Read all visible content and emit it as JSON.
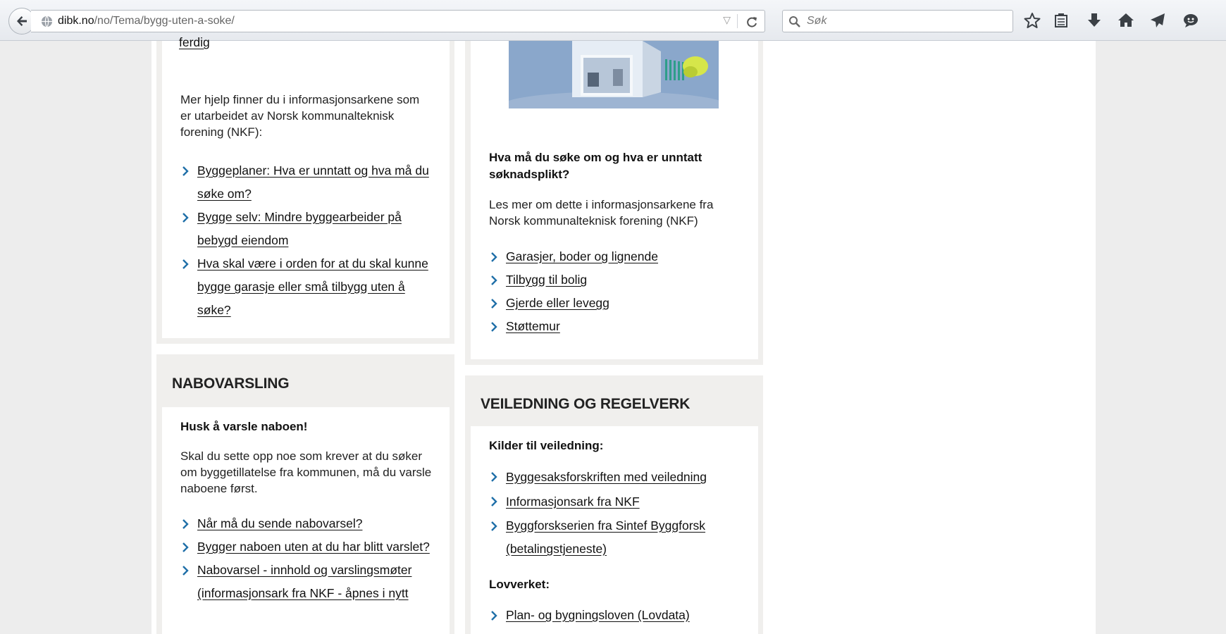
{
  "browser": {
    "url_host": "dibk.no",
    "url_path": "/no/Tema/bygg-uten-a-soke/",
    "search_placeholder": "Søk"
  },
  "left_top": {
    "cutoff_link": "ferdig",
    "intro": "Mer hjelp finner du i informasjonsarkene som er utarbeidet av Norsk kommunalteknisk forening (NKF):",
    "links": [
      "Byggeplaner: Hva er unntatt og hva må du søke om?",
      "Bygge selv: Mindre byggearbeider på bebygd eiendom",
      "Hva skal være i orden for at du skal kunne bygge garasje eller små tilbygg uten å søke?"
    ]
  },
  "nabovarsling": {
    "heading": "NABOVARSLING",
    "subheading": "Husk å varsle naboen!",
    "text": "Skal du sette opp noe som krever at du søker om byggetillatelse fra kommunen, må du varsle naboene først.",
    "links": [
      "Når må du sende nabovarsel?",
      "Bygger naboen uten at du har blitt varslet?",
      "Nabovarsel - innhold og varslingsmøter (informasjonsark fra NKF - åpnes i nytt"
    ]
  },
  "middle_top": {
    "subheading": "Hva må du søke om og hva er unntatt søknadsplikt?",
    "text": "Les mer om dette i informasjonsarkene fra Norsk kommunalteknisk forening (NKF)",
    "links": [
      "Garasjer, boder og lignende",
      "Tilbygg til bolig",
      "Gjerde eller levegg",
      "Støttemur"
    ]
  },
  "veiledning": {
    "heading": "VEILEDNING OG REGELVERK",
    "sub1": "Kilder til veiledning:",
    "links1": [
      "Byggesaksforskriften med veiledning",
      "Informasjonsark fra NKF",
      "Byggforskserien fra Sintef Byggforsk (betalingstjeneste)"
    ],
    "sub2": "Lovverket:",
    "links2": [
      "Plan- og bygningsloven (Lovdata)"
    ]
  },
  "colors": {
    "card_bg": "#f0efed",
    "link": "#111111",
    "chevron": "#1f6fa8"
  }
}
